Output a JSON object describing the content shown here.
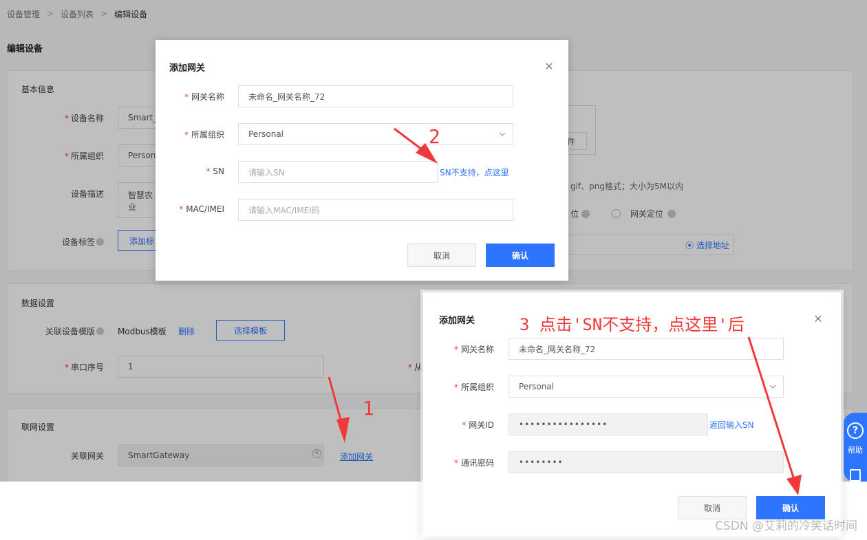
{
  "breadcrumb": {
    "items": [
      "设备管理",
      "设备列表",
      "编辑设备"
    ]
  },
  "page_title": "编辑设备",
  "basic": {
    "title": "基本信息",
    "device_name_label": "设备名称",
    "device_name_value": "Smart_",
    "org_label": "所属组织",
    "org_value": "Persona",
    "desc_label": "设备描述",
    "desc_value": "智慧农业",
    "tags_label": "设备标签",
    "add_tag_button": "添加标",
    "upload_file_button": "件",
    "upload_hint": "gif、png格式；大小为5M以内",
    "locate_device": "位",
    "locate_gateway": "网关定位",
    "select_address": "选择地址"
  },
  "data_settings": {
    "title": "数据设置",
    "template_label": "关联设备模版",
    "template_value": "Modbus模板",
    "delete_link": "删除",
    "select_template_button": "选择模板",
    "serial_label": "串口序号",
    "serial_value": "1",
    "slave_label": "从"
  },
  "network": {
    "title": "联网设置",
    "gateway_label": "关联网关",
    "gateway_value": "SmartGateway",
    "add_gateway_link": "添加网关"
  },
  "modal1": {
    "title": "添加网关",
    "name_label": "网关名称",
    "name_value": "未命名_网关名称_72",
    "org_label": "所属组织",
    "org_value": "Personal",
    "sn_label": "SN",
    "sn_placeholder": "请输入SN",
    "sn_unsupported_link": "SN不支持，点这里",
    "mac_label": "MAC/IMEI",
    "mac_placeholder": "请输入MAC/IMEI码",
    "cancel": "取消",
    "confirm": "确认"
  },
  "modal2": {
    "title": "添加网关",
    "name_label": "网关名称",
    "name_value": "未命名_网关名称_72",
    "org_label": "所属组织",
    "org_value": "Personal",
    "gateway_id_label": "网关ID",
    "gateway_id_value": "••••••••••••••••",
    "back_to_sn_link": "返回输入SN",
    "password_label": "通讯密码",
    "password_value": "••••••••",
    "cancel": "取消",
    "confirm": "确认"
  },
  "annotations": {
    "step1": "1",
    "step2": "2",
    "step3": "3 点击'SN不支持，点这里'后",
    "color": "#f03a3a"
  },
  "side_help": {
    "label": "帮助"
  },
  "watermark": "CSDN @艾莉的冷笑话时间",
  "colors": {
    "primary": "#2d74ff",
    "required": "#e54545",
    "annotation": "#f03a3a"
  }
}
